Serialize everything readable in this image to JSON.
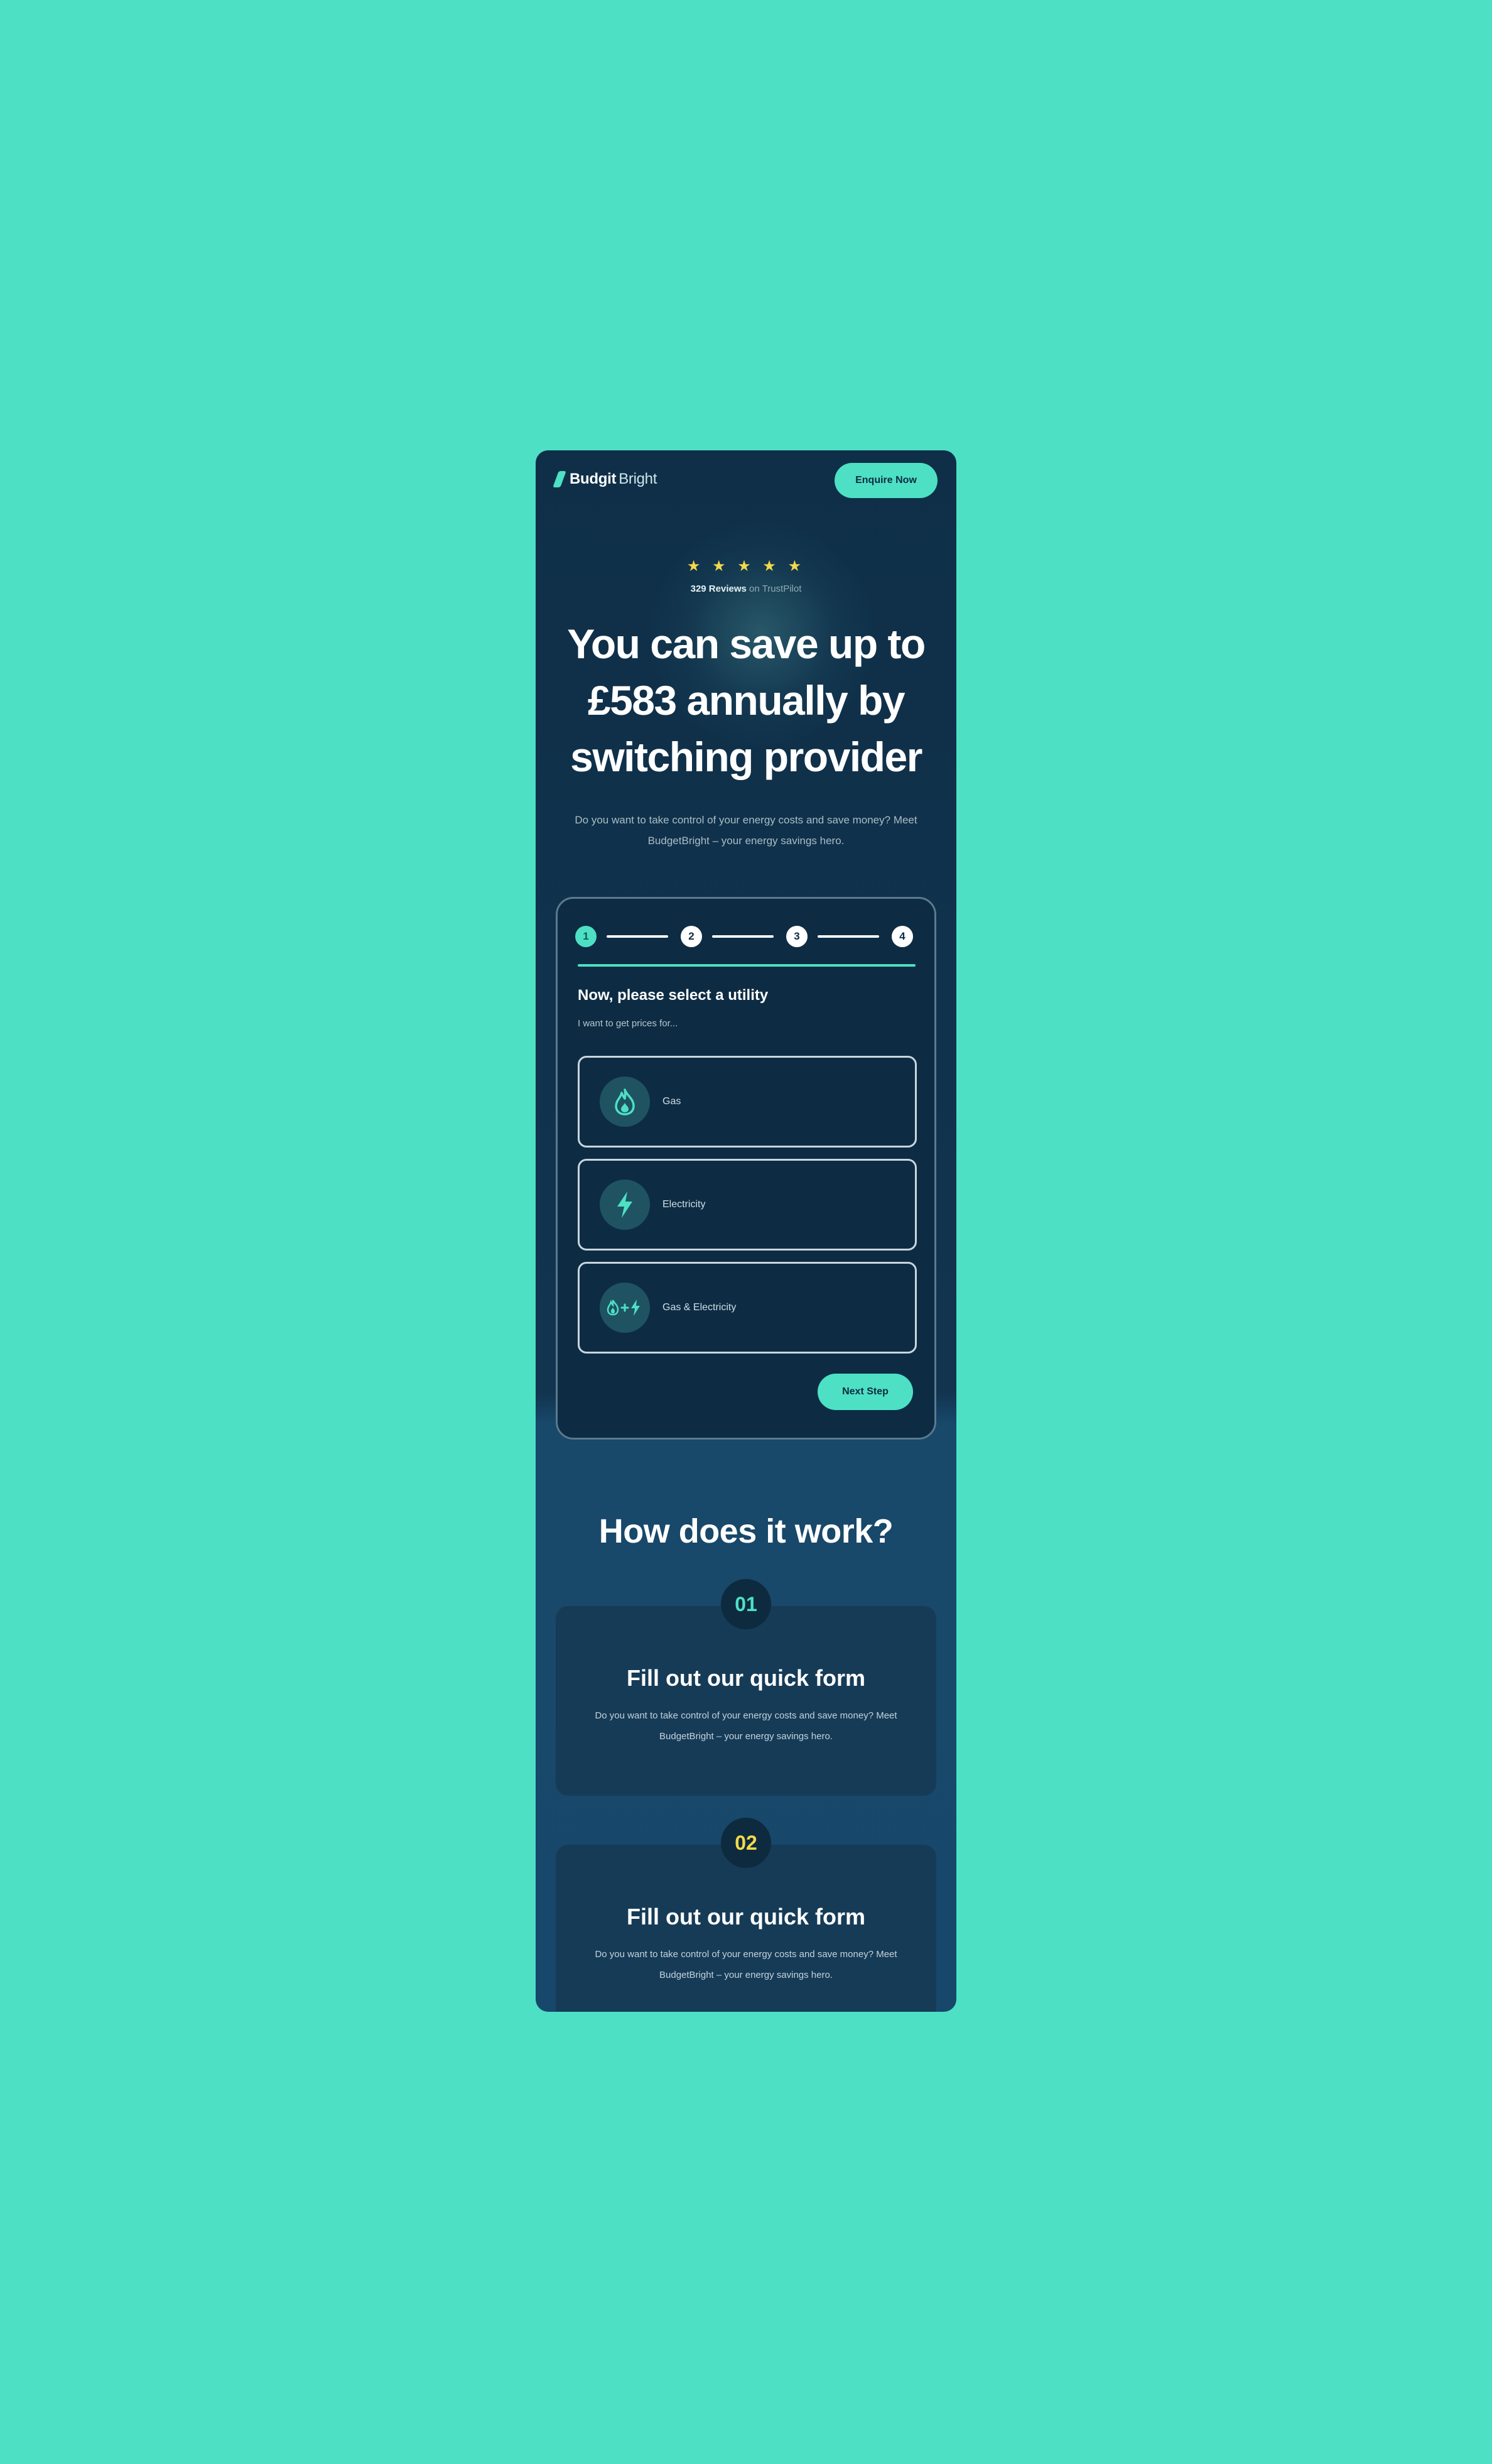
{
  "colors": {
    "background": "#4de0c5",
    "accent": "#4de0c5",
    "panel": "#0f2f48",
    "star": "#f3d94a"
  },
  "header": {
    "logo_bold": "Budgit",
    "logo_light": "Bright",
    "enquire_label": "Enquire Now"
  },
  "hero": {
    "stars": "★ ★ ★ ★ ★",
    "review_count": "329 Reviews",
    "review_source": "on TrustPilot",
    "title": "You can save up to £583 annually by switching provider",
    "subtitle": "Do you want to take control of your energy costs and save money? Meet BudgetBright – your energy savings hero."
  },
  "form": {
    "steps": [
      "1",
      "2",
      "3",
      "4"
    ],
    "active_step": 1,
    "title": "Now, please select a utility",
    "subtitle": "I want to get prices for...",
    "options": [
      {
        "label": "Gas",
        "icon": "flame-icon"
      },
      {
        "label": "Electricity",
        "icon": "lightning-icon"
      },
      {
        "label": "Gas & Electricity",
        "icon": "flame-plus-lightning-icon"
      }
    ],
    "next_label": "Next Step"
  },
  "how": {
    "title": "How does it work?",
    "steps": [
      {
        "number": "01",
        "number_color": "#4de0c5",
        "title": "Fill out our quick form",
        "text": "Do you want to take control of your energy costs and save money? Meet BudgetBright – your energy savings hero."
      },
      {
        "number": "02",
        "number_color": "#f3d94a",
        "title": "Fill out our quick form",
        "text": "Do you want to take control of your energy costs and save money? Meet BudgetBright – your energy savings hero."
      }
    ]
  }
}
